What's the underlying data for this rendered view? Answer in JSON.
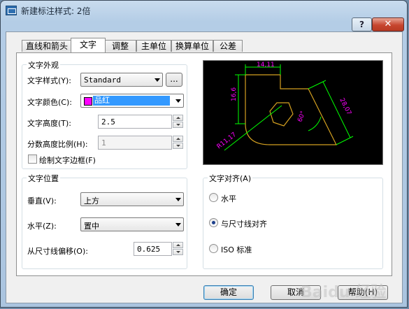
{
  "window": {
    "title": "新建标注样式: 2倍",
    "help_label": "?",
    "close_label": "✕"
  },
  "tabs": [
    {
      "label": "直线和箭头"
    },
    {
      "label": "文字"
    },
    {
      "label": "调整"
    },
    {
      "label": "主单位"
    },
    {
      "label": "换算单位"
    },
    {
      "label": "公差"
    }
  ],
  "text_appearance": {
    "title": "文字外观",
    "style_label": "文字样式(Y):",
    "style_value": "Standard",
    "style_browse": "...",
    "color_label": "文字颜色(C):",
    "color_value": "品红",
    "color_swatch": "#ff00ff",
    "height_label": "文字高度(T):",
    "height_value": "2.5",
    "fraction_label": "分数高度比例(H):",
    "fraction_value": "1",
    "frame_label": "绘制文字边框(F)"
  },
  "text_placement": {
    "title": "文字位置",
    "vertical_label": "垂直(V):",
    "vertical_value": "上方",
    "horizontal_label": "水平(Z):",
    "horizontal_value": "置中",
    "offset_label": "从尺寸线偏移(O):",
    "offset_value": "0.625"
  },
  "text_alignment": {
    "title": "文字对齐(A)",
    "options": [
      "水平",
      "与尺寸线对齐",
      "ISO 标准"
    ],
    "selected": "与尺寸线对齐"
  },
  "preview": {
    "dim_top": "14,11",
    "dim_left": "16,6",
    "dim_right": "28,07",
    "dim_angle": "60°",
    "dim_radius": "R11,17",
    "geometry_color": "#d4a020",
    "dimension_color": "#00ff00",
    "text_color": "#ff00ff"
  },
  "buttons": {
    "ok": "确定",
    "cancel": "取消",
    "help": "帮助(H)"
  },
  "watermark": "Baidu 经验"
}
